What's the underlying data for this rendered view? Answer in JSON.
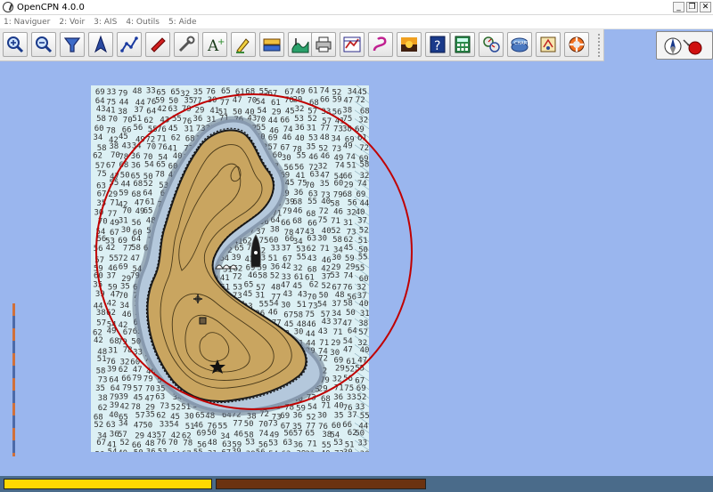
{
  "window": {
    "title": "OpenCPN 4.0.0",
    "controls": {
      "minimize": "_",
      "restore": "❐",
      "close": "✕"
    }
  },
  "menu": [
    {
      "label": "1: Naviguer"
    },
    {
      "label": "2: Voir"
    },
    {
      "label": "3: AIS"
    },
    {
      "label": "4: Outils"
    },
    {
      "label": "5: Aide"
    }
  ],
  "toolbar": {
    "buttons": [
      {
        "icon": "zoom-in-icon"
      },
      {
        "icon": "zoom-out-icon"
      },
      {
        "icon": "chart-quilt-icon"
      },
      {
        "icon": "follow-ship-icon"
      },
      {
        "icon": "route-icon"
      },
      {
        "icon": "mark-icon"
      },
      {
        "icon": "tools-icon"
      },
      {
        "icon": "text-annotation-icon"
      },
      {
        "icon": "draw-icon"
      },
      {
        "icon": "tide-icon"
      },
      {
        "icon": "current-icon"
      },
      {
        "icon": "print-icon"
      },
      {
        "icon": "route-manager-icon"
      },
      {
        "icon": "track-icon"
      },
      {
        "icon": "color-scheme-icon"
      },
      {
        "icon": "help-icon"
      },
      {
        "icon": "calculator-icon"
      },
      {
        "icon": "dashboard-icon"
      },
      {
        "icon": "chart-database-icon"
      },
      {
        "icon": "logbook-icon"
      },
      {
        "icon": "man-overboard-icon"
      }
    ]
  },
  "mini_toolbar": {
    "icon": "compass-gps-icon"
  },
  "chart": {
    "depth_soundings": [
      "72",
      "70",
      "74",
      "71",
      "73",
      "69",
      "75",
      "68",
      "65",
      "63",
      "58",
      "61",
      "67",
      "64",
      "66",
      "62",
      "60",
      "55",
      "59",
      "57",
      "43",
      "41",
      "34",
      "38",
      "36",
      "33",
      "31",
      "29",
      "76",
      "77",
      "79",
      "78",
      "52",
      "51",
      "50",
      "54",
      "56",
      "53",
      "49",
      "48",
      "47",
      "46",
      "45",
      "44",
      "42",
      "40",
      "39",
      "37",
      "35",
      "32",
      "30"
    ],
    "colors": {
      "sea": "#dcf0f4",
      "land": "#c9a560",
      "circle": "#c00000"
    },
    "symbols": [
      "anchorage-icon",
      "beacon-icon",
      "summit-star-icon",
      "ship-icon",
      "wreck-icon"
    ]
  },
  "status": {
    "field1": "",
    "field2": ""
  }
}
